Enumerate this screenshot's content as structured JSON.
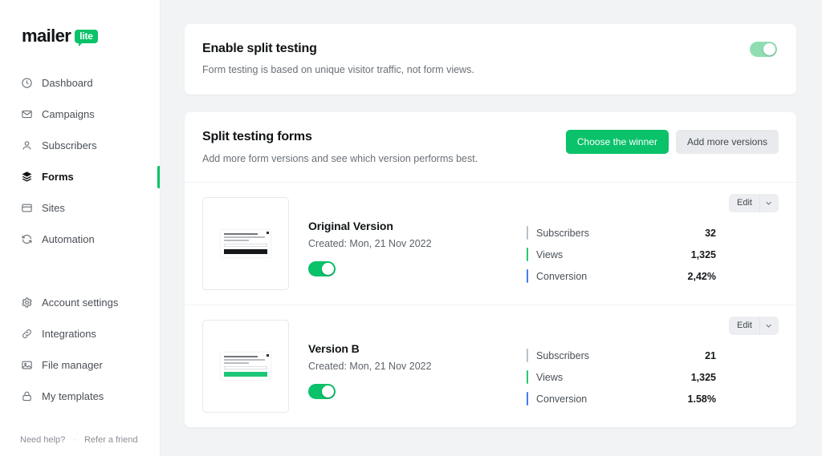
{
  "brand": {
    "name": "mailer",
    "badge": "lite",
    "accent": "#09c269"
  },
  "sidebar": {
    "primary_items": [
      {
        "label": "Dashboard",
        "icon": "dashboard-icon",
        "active": false
      },
      {
        "label": "Campaigns",
        "icon": "envelope-icon",
        "active": false
      },
      {
        "label": "Subscribers",
        "icon": "user-icon",
        "active": false
      },
      {
        "label": "Forms",
        "icon": "layers-icon",
        "active": true
      },
      {
        "label": "Sites",
        "icon": "window-icon",
        "active": false
      },
      {
        "label": "Automation",
        "icon": "refresh-icon",
        "active": false
      }
    ],
    "secondary_items": [
      {
        "label": "Account settings",
        "icon": "gear-icon"
      },
      {
        "label": "Integrations",
        "icon": "link-icon"
      },
      {
        "label": "File manager",
        "icon": "image-icon"
      },
      {
        "label": "My templates",
        "icon": "lock-icon"
      }
    ],
    "footer": {
      "help": "Need help?",
      "separator": "·",
      "refer": "Refer a friend"
    }
  },
  "enable_card": {
    "title": "Enable split testing",
    "subtitle": "Form testing is based on unique visitor traffic, not form views.",
    "toggle_on": true
  },
  "forms_card": {
    "title": "Split testing forms",
    "subtitle": "Add more form versions and see which version performs best.",
    "primary_button": "Choose the winner",
    "secondary_button": "Add more versions",
    "edit_label": "Edit",
    "stat_colors": {
      "subscribers": "#b7c2c9",
      "views": "#28c76f",
      "conversion": "#3d7ff5"
    },
    "rows": [
      {
        "name": "Original Version",
        "created": "Created: Mon, 21 Nov 2022",
        "toggle_on": true,
        "thumb_button": "dark",
        "stats": [
          {
            "label": "Subscribers",
            "value": "32"
          },
          {
            "label": "Views",
            "value": "1,325"
          },
          {
            "label": "Conversion",
            "value": "2,42%"
          }
        ]
      },
      {
        "name": "Version B",
        "created": "Created: Mon, 21 Nov 2022",
        "toggle_on": true,
        "thumb_button": "green",
        "stats": [
          {
            "label": "Subscribers",
            "value": "21"
          },
          {
            "label": "Views",
            "value": "1,325"
          },
          {
            "label": "Conversion",
            "value": "1.58%"
          }
        ]
      }
    ]
  }
}
